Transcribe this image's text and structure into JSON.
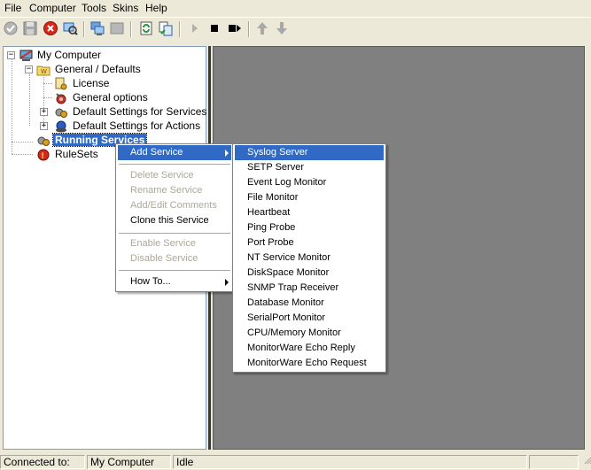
{
  "menubar": {
    "file": "File",
    "computer": "Computer",
    "tools": "Tools",
    "skins": "Skins",
    "help": "Help"
  },
  "tree": {
    "my_computer": "My Computer",
    "general_defaults": "General / Defaults",
    "license": "License",
    "general_options": "General options",
    "default_services": "Default Settings for Services",
    "default_actions": "Default Settings for Actions",
    "running_services": "Running Services",
    "rulesets": "RuleSets"
  },
  "context_menu": {
    "add_service": "Add Service",
    "delete_service": "Delete Service",
    "rename_service": "Rename Service",
    "add_edit_comments": "Add/Edit Comments",
    "clone_service": "Clone this Service",
    "enable_service": "Enable Service",
    "disable_service": "Disable Service",
    "how_to": "How To..."
  },
  "submenu": {
    "items": [
      "Syslog Server",
      "SETP Server",
      "Event Log Monitor",
      "File Monitor",
      "Heartbeat",
      "Ping Probe",
      "Port Probe",
      "NT Service Monitor",
      "DiskSpace Monitor",
      "SNMP Trap Receiver",
      "Database Monitor",
      "SerialPort Monitor",
      "CPU/Memory Monitor",
      "MonitorWare Echo Reply",
      "MonitorWare Echo Request"
    ]
  },
  "statusbar": {
    "connection": "Connected to:",
    "computer": "My Computer",
    "state": "Idle"
  },
  "colors": {
    "selection": "#316ac5",
    "chrome": "#ece9d8",
    "workspace": "#808080"
  }
}
